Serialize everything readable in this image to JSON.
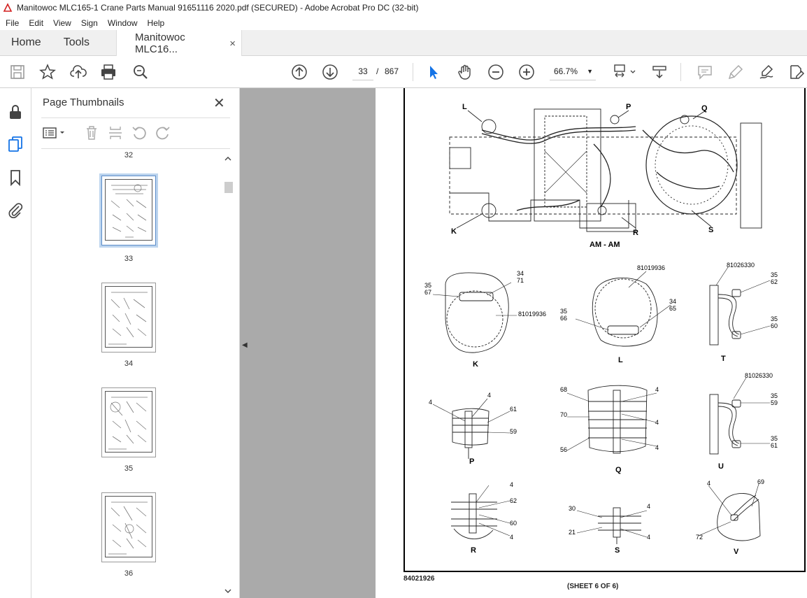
{
  "window": {
    "title": "Manitowoc MLC165-1 Crane Parts Manual 91651116 2020.pdf (SECURED) - Adobe Acrobat Pro DC (32-bit)"
  },
  "menu": [
    "File",
    "Edit",
    "View",
    "Sign",
    "Window",
    "Help"
  ],
  "tabs": {
    "home": "Home",
    "tools": "Tools",
    "document": "Manitowoc MLC16...",
    "close": "×"
  },
  "toolbar": {
    "current_page": "33",
    "page_sep": "/",
    "total_pages": "867",
    "zoom": "66.7%",
    "icons": [
      "save-icon",
      "bookmark-star-icon",
      "upload-icon",
      "print-icon",
      "zoom-search-icon",
      "page-up-icon",
      "page-down-icon",
      "select-cursor-icon",
      "hand-icon",
      "zoom-out-icon",
      "zoom-in-icon",
      "fit-page-icon",
      "scroll-mode-icon",
      "comment-icon",
      "highlight-icon",
      "sign-icon",
      "edit-pdf-icon"
    ]
  },
  "panel": {
    "title": "Page Thumbnails",
    "close": "✕",
    "thumbnails": [
      {
        "label": "32"
      },
      {
        "label": "33",
        "selected": true
      },
      {
        "label": "34"
      },
      {
        "label": "35"
      },
      {
        "label": "36"
      }
    ]
  },
  "drawing": {
    "section_label": "AM - AM",
    "callouts_top": [
      "L",
      "P",
      "Q",
      "K",
      "R",
      "S"
    ],
    "details": [
      {
        "letter": "K",
        "numbers": [
          "35",
          "67",
          "34",
          "71",
          "81019936"
        ]
      },
      {
        "letter": "L",
        "numbers": [
          "81019936",
          "35",
          "66",
          "34",
          "65"
        ]
      },
      {
        "letter": "T",
        "numbers": [
          "81026330",
          "35",
          "62",
          "35",
          "60"
        ]
      },
      {
        "letter": "P",
        "numbers": [
          "4",
          "4",
          "61",
          "59"
        ]
      },
      {
        "letter": "Q",
        "numbers": [
          "68",
          "4",
          "70",
          "4",
          "56",
          "4"
        ]
      },
      {
        "letter": "U",
        "numbers": [
          "81026330",
          "35",
          "59",
          "35",
          "61"
        ]
      },
      {
        "letter": "R",
        "numbers": [
          "4",
          "62",
          "60",
          "4"
        ]
      },
      {
        "letter": "S",
        "numbers": [
          "30",
          "4",
          "21",
          "4"
        ]
      },
      {
        "letter": "V",
        "numbers": [
          "4",
          "69",
          "72"
        ]
      }
    ],
    "footer_number": "84021926",
    "sheet_label": "(SHEET 6 OF 6)"
  }
}
